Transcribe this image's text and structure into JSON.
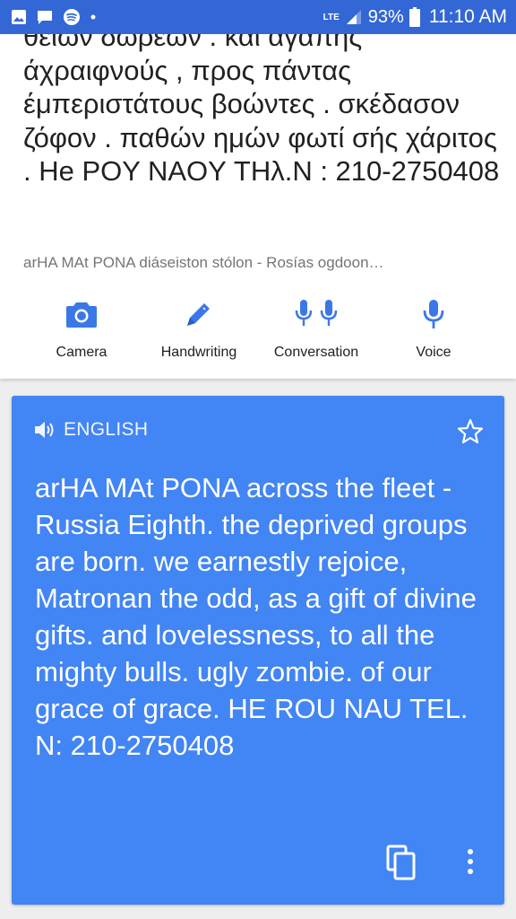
{
  "status_bar": {
    "battery_percent": "93%",
    "time": "11:10 AM",
    "network_label": "LTE",
    "left_icons": [
      "photo-notification-icon",
      "chat-notification-icon",
      "spotify-icon",
      "dot-icon"
    ],
    "right_icons": [
      "signal-icon",
      "battery-icon"
    ]
  },
  "source": {
    "text": "θείων δωρεών . και αγάπης άχραιφνούς , προς πάντας έμπεριστάτους βοώντες . σκέδασον ζόφον . παθών ημών φωτί σής χάριτος . He POY NAOY ΤΗλ.N : 210-2750408",
    "romanized": "arHA MAt PONA diáseiston stólon - Rosías ogdoon…"
  },
  "tools": [
    {
      "label": "Camera",
      "icon": "camera-icon"
    },
    {
      "label": "Handwriting",
      "icon": "pen-icon"
    },
    {
      "label": "Conversation",
      "icon": "conversation-mic-icon"
    },
    {
      "label": "Voice",
      "icon": "mic-icon"
    }
  ],
  "result": {
    "language": "ENGLISH",
    "translation": "arHA MAt PONA across the fleet - Russia Eighth. the deprived groups are born. we earnestly rejoice, Matronan the odd, as a gift of divine gifts. and lovelessness, to all the mighty bulls. ugly zombie. of our grace of grace. HE ROU NAU TEL. N: 210-2750408"
  },
  "colors": {
    "status_bar": "#3367d6",
    "result_card": "#4285f4",
    "tool_icon": "#3b78e7"
  }
}
